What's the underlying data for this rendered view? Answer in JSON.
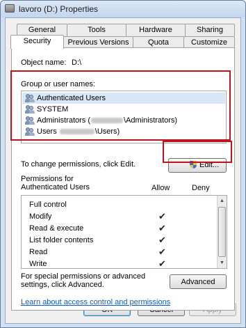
{
  "window": {
    "title": "lavoro (D:) Properties"
  },
  "tabs": {
    "row1": [
      "General",
      "Tools",
      "Hardware",
      "Sharing"
    ],
    "row2": [
      "Security",
      "Previous Versions",
      "Quota",
      "Customize"
    ],
    "active": "Security"
  },
  "security": {
    "object_name_label": "Object name:",
    "object_name_value": "D:\\",
    "group_label": "Group or user names:",
    "users": [
      {
        "label": "Authenticated Users",
        "selected": true,
        "icon": "users-icon"
      },
      {
        "label": "SYSTEM",
        "selected": false,
        "icon": "users-icon"
      },
      {
        "label_prefix": "Administrators (",
        "label_suffix": "\\Administrators)",
        "selected": false,
        "icon": "users-icon"
      },
      {
        "label_prefix": "Users ",
        "label_suffix": "\\Users)",
        "selected": false,
        "icon": "users-icon"
      }
    ],
    "change_text": "To change permissions, click Edit.",
    "edit_button": "Edit...",
    "permissions_for": "Permissions for Authenticated Users",
    "allow_header": "Allow",
    "deny_header": "Deny",
    "permissions": [
      {
        "name": "Full control",
        "allow": false,
        "deny": false
      },
      {
        "name": "Modify",
        "allow": true,
        "deny": false
      },
      {
        "name": "Read & execute",
        "allow": true,
        "deny": false
      },
      {
        "name": "List folder contents",
        "allow": true,
        "deny": false
      },
      {
        "name": "Read",
        "allow": true,
        "deny": false
      },
      {
        "name": "Write",
        "allow": true,
        "deny": false
      }
    ],
    "check_glyph": "✔",
    "special_text": "For special permissions or advanced settings, click Advanced.",
    "advanced_button": "Advanced",
    "learn_link": "Learn about access control and permissions"
  },
  "footer": {
    "ok": "OK",
    "cancel": "Cancel",
    "apply": "Apply"
  },
  "colors": {
    "highlight": "#c0121a",
    "link": "#0b5cc4",
    "selection": "#d9e6f5"
  }
}
